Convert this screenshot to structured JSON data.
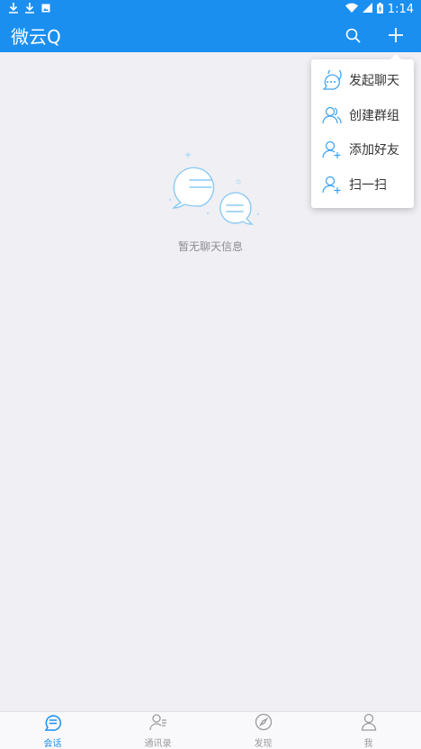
{
  "status_bar": {
    "left_icons": [
      "download-icon",
      "download-icon",
      "image-icon"
    ],
    "right_icons": [
      "wifi-icon",
      "signal-icon",
      "battery-icon"
    ],
    "time": "1:14"
  },
  "app_bar": {
    "title": "微云Q",
    "actions": [
      "search-icon",
      "plus-icon"
    ]
  },
  "empty_state": {
    "icon": "chat-bubbles-icon",
    "text": "暂无聊天信息"
  },
  "popup_menu": {
    "items": [
      {
        "label": "发起聊天",
        "icon": "chat-bubble-icon"
      },
      {
        "label": "创建群组",
        "icon": "group-icon"
      },
      {
        "label": "添加好友",
        "icon": "add-user-icon"
      },
      {
        "label": "扫一扫",
        "icon": "scan-user-icon"
      }
    ]
  },
  "bottom_nav": {
    "items": [
      {
        "label": "会话",
        "icon": "chat-icon",
        "active": true
      },
      {
        "label": "通讯录",
        "icon": "contacts-icon",
        "active": false
      },
      {
        "label": "发现",
        "icon": "compass-icon",
        "active": false
      },
      {
        "label": "我",
        "icon": "profile-icon",
        "active": false
      }
    ]
  },
  "colors": {
    "primary": "#1b8ff0",
    "background": "#efeff4",
    "text_muted": "#9a9aa0"
  }
}
